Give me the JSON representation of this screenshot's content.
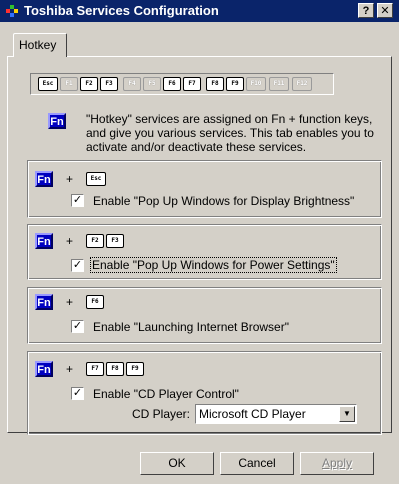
{
  "window": {
    "title": "Toshiba Services Configuration",
    "help_label": "?",
    "close_label": "✕",
    "icon": "toshiba-app-icon"
  },
  "tabs": [
    {
      "label": "Hotkey",
      "active": true
    }
  ],
  "keyboard": {
    "keys": [
      {
        "label": "Esc",
        "enabled": true
      },
      {
        "label": "F1",
        "enabled": false
      },
      {
        "label": "F2",
        "enabled": true
      },
      {
        "label": "F3",
        "enabled": true
      },
      {
        "label": "F4",
        "enabled": false
      },
      {
        "label": "F5",
        "enabled": false
      },
      {
        "label": "F6",
        "enabled": true
      },
      {
        "label": "F7",
        "enabled": true
      },
      {
        "label": "F8",
        "enabled": true
      },
      {
        "label": "F9",
        "enabled": true
      },
      {
        "label": "F10",
        "enabled": false
      },
      {
        "label": "F11",
        "enabled": false
      },
      {
        "label": "F12",
        "enabled": false
      }
    ]
  },
  "fn_label": "Fn",
  "plus": "+",
  "description": "\"Hotkey\" services are assigned on Fn + function keys, and give you various services. This tab enables you to activate and/or deactivate these services.",
  "groups": [
    {
      "keys": [
        "Esc"
      ],
      "checked": true,
      "label": "Enable \"Pop Up Windows for Display Brightness\""
    },
    {
      "keys": [
        "F2",
        "F3"
      ],
      "checked": true,
      "label": "Enable \"Pop Up Windows for Power Settings\""
    },
    {
      "keys": [
        "F6"
      ],
      "checked": true,
      "label": "Enable \"Launching Internet Browser\""
    },
    {
      "keys": [
        "F7",
        "F8",
        "F9"
      ],
      "checked": true,
      "label": "Enable \"CD Player Control\""
    }
  ],
  "cd_player": {
    "label": "CD Player:",
    "value": "Microsoft CD Player"
  },
  "buttons": {
    "ok": "OK",
    "cancel": "Cancel",
    "apply": "Apply"
  }
}
